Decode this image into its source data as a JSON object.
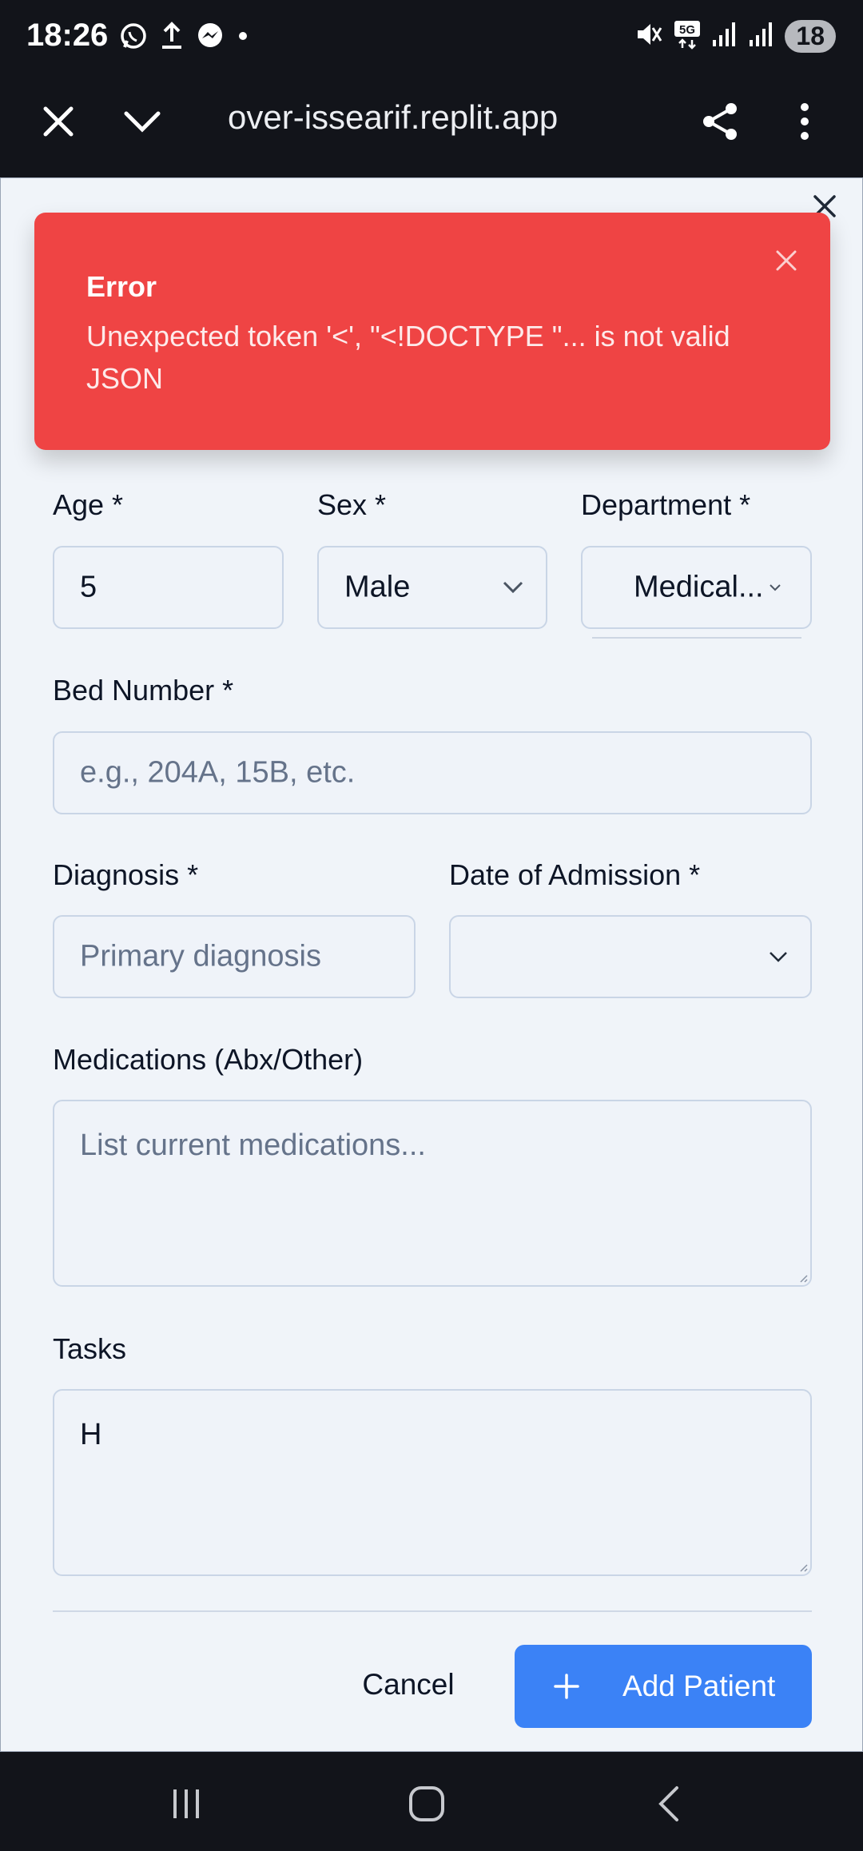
{
  "status_bar": {
    "time": "18:26",
    "battery": "18",
    "network": "5G",
    "left_icons": [
      "whatsapp-icon",
      "upload-icon",
      "messenger-icon",
      "dot-icon"
    ],
    "right_icons": [
      "mute-icon",
      "5g-icon",
      "signal-icon",
      "signal-icon"
    ]
  },
  "browser": {
    "url": "over-issearif.replit.app",
    "icons": [
      "close-icon",
      "chevron-down-icon",
      "share-icon",
      "more-vertical-icon"
    ]
  },
  "toast": {
    "title": "Error",
    "message": "Unexpected token '<', \"<!DOCTYPE \"... is not valid JSON",
    "bg_color": "#ef4444"
  },
  "form": {
    "age": {
      "label": "Age *",
      "value": "5"
    },
    "sex": {
      "label": "Sex *",
      "value": "Male"
    },
    "department": {
      "label": "Department *",
      "value": "Medical..."
    },
    "bed_number": {
      "label": "Bed Number *",
      "placeholder": "e.g., 204A, 15B, etc."
    },
    "diagnosis": {
      "label": "Diagnosis *",
      "placeholder": "Primary diagnosis"
    },
    "date_of_admission": {
      "label": "Date of Admission *",
      "value": ""
    },
    "medications": {
      "label": "Medications (Abx/Other)",
      "placeholder": "List current medications..."
    },
    "tasks": {
      "label": "Tasks",
      "value": "H"
    }
  },
  "actions": {
    "cancel_label": "Cancel",
    "add_label": "Add Patient",
    "accent_color": "#3b82f6"
  },
  "nav_bar": {
    "icons": [
      "recent-apps-icon",
      "home-icon",
      "back-icon"
    ]
  }
}
